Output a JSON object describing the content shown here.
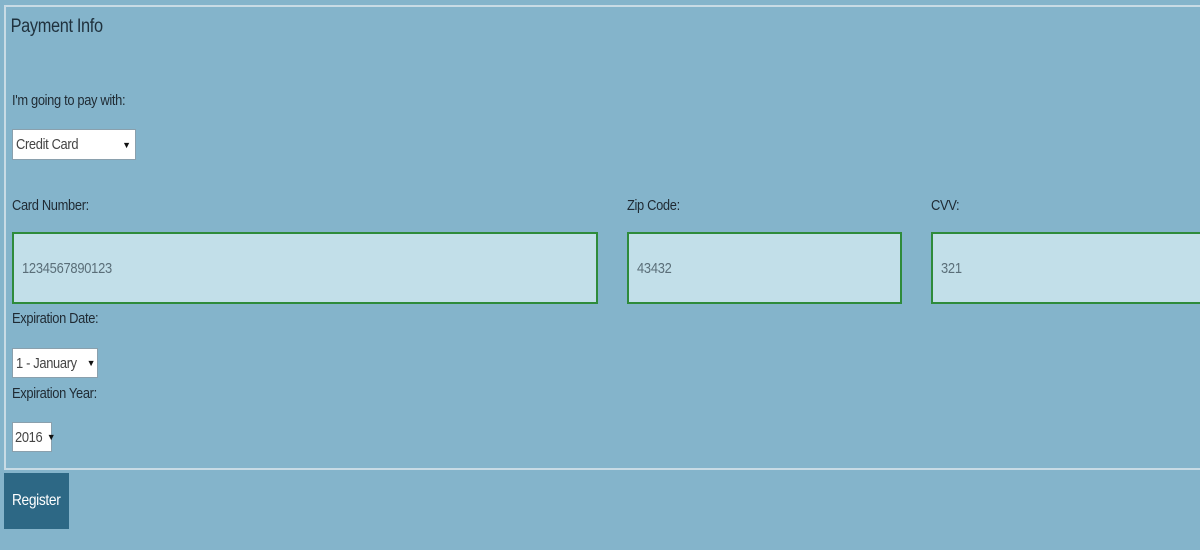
{
  "payment": {
    "legend": "Payment Info",
    "pay_with_label": "I'm going to pay with:",
    "pay_with_value": "Credit Card",
    "card_number_label": "Card Number:",
    "card_number_value": "1234567890123",
    "zip_label": "Zip Code:",
    "zip_value": "43432",
    "cvv_label": "CVV:",
    "cvv_value": "321",
    "exp_date_label": "Expiration Date:",
    "exp_date_value": "1 - January",
    "exp_year_label": "Expiration Year:",
    "exp_year_value": "2016"
  },
  "actions": {
    "register_label": "Register"
  },
  "colors": {
    "background": "#84b4cb",
    "input_background": "#c2dfe9",
    "input_border_valid": "#2e8b3b",
    "button_background": "#2d6885"
  }
}
